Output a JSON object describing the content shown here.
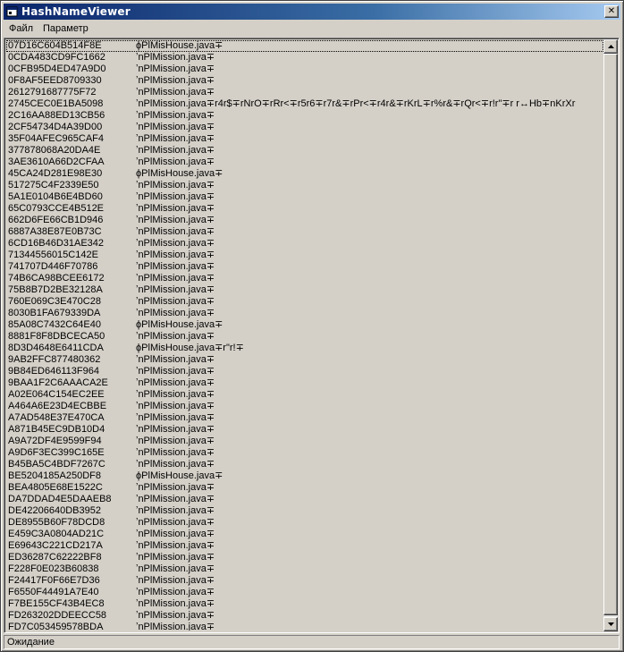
{
  "window": {
    "title": "HashNameViewer",
    "close_glyph": "✕"
  },
  "menu": {
    "items": [
      "Файл",
      "Параметр"
    ]
  },
  "list": {
    "rows": [
      {
        "hash": "07D16C604B514F8E",
        "name": "ϕPlMisHouse.java∓"
      },
      {
        "hash": "0CDA483CD9FC1662",
        "name": "ʼnPlMission.java∓"
      },
      {
        "hash": "0CFB95D4ED47A9D0",
        "name": "ʼnPlMission.java∓"
      },
      {
        "hash": "0F8AF5EED8709330",
        "name": "ʼnPlMission.java∓"
      },
      {
        "hash": "2612791687775F72",
        "name": "ʼnPlMission.java∓"
      },
      {
        "hash": "2745CEC0E1BA5098",
        "name": "ʼnPlMission.java∓r4r$∓rNrO∓rRr<∓r5r6∓r7r&∓rPr<∓r4r&∓rKrL∓r%r&∓rQr<∓r!r\"∓r r↔Hb∓nKrXr"
      },
      {
        "hash": "2C16AA88ED13CB56",
        "name": "ʼnPlMission.java∓"
      },
      {
        "hash": "2CF54734D4A39D00",
        "name": "ʼnPlMission.java∓"
      },
      {
        "hash": "35F04AFEC965CAF4",
        "name": "ʼnPlMission.java∓"
      },
      {
        "hash": "377878068A20DA4E",
        "name": "ʼnPlMission.java∓"
      },
      {
        "hash": "3AE3610A66D2CFAA",
        "name": "ʼnPlMission.java∓"
      },
      {
        "hash": "45CA24D281E98E30",
        "name": "ϕPlMisHouse.java∓"
      },
      {
        "hash": "517275C4F2339E50",
        "name": "ʼnPlMission.java∓"
      },
      {
        "hash": "5A1E0104B6E4BD60",
        "name": "ʼnPlMission.java∓"
      },
      {
        "hash": "65C0793CCE4B512E",
        "name": "ʼnPlMission.java∓"
      },
      {
        "hash": "662D6FE66CB1D946",
        "name": "ʼnPlMission.java∓"
      },
      {
        "hash": "6887A38E87E0B73C",
        "name": "ʼnPlMission.java∓"
      },
      {
        "hash": "6CD16B46D31AE342",
        "name": "ʼnPlMission.java∓"
      },
      {
        "hash": "71344556015C142E",
        "name": "ʼnPlMission.java∓"
      },
      {
        "hash": "741707D446F70786",
        "name": "ʼnPlMission.java∓"
      },
      {
        "hash": "74B6CA98BCEE6172",
        "name": "ʼnPlMission.java∓"
      },
      {
        "hash": "75B8B7D2BE32128A",
        "name": "ʼnPlMission.java∓"
      },
      {
        "hash": "760E069C3E470C28",
        "name": "ʼnPlMission.java∓"
      },
      {
        "hash": "8030B1FA679339DA",
        "name": "ʼnPlMission.java∓"
      },
      {
        "hash": "85A08C7432C64E40",
        "name": "ϕPlMisHouse.java∓"
      },
      {
        "hash": "8881F8F8DBCECA50",
        "name": "ʼnPlMission.java∓"
      },
      {
        "hash": "8D3D4648E6411CDA",
        "name": "ϕPlMisHouse.java∓r\"r!∓"
      },
      {
        "hash": "9AB2FFC877480362",
        "name": "ʼnPlMission.java∓"
      },
      {
        "hash": "9B84ED646113F964",
        "name": "ʼnPlMission.java∓"
      },
      {
        "hash": "9BAA1F2C6AAACA2E",
        "name": "ʼnPlMission.java∓"
      },
      {
        "hash": "A02E064C154EC2EE",
        "name": "ʼnPlMission.java∓"
      },
      {
        "hash": "A464A6E23D4ECBBE",
        "name": "ʼnPlMission.java∓"
      },
      {
        "hash": "A7AD548E37E470CA",
        "name": "ʼnPlMission.java∓"
      },
      {
        "hash": "A871B45EC9DB10D4",
        "name": "ʼnPlMission.java∓"
      },
      {
        "hash": "A9A72DF4E9599F94",
        "name": "ʼnPlMission.java∓"
      },
      {
        "hash": "A9D6F3EC399C165E",
        "name": "ʼnPlMission.java∓"
      },
      {
        "hash": "B45BA5C4BDF7267C",
        "name": "ʼnPlMission.java∓"
      },
      {
        "hash": "BE5204185A250DF8",
        "name": "ϕPlMisHouse.java∓"
      },
      {
        "hash": "BEA4805E68E1522C",
        "name": "ʼnPlMission.java∓"
      },
      {
        "hash": "DA7DDAD4E5DAAEB8",
        "name": "ʼnPlMission.java∓"
      },
      {
        "hash": "DE42206640DB3952",
        "name": "ʼnPlMission.java∓"
      },
      {
        "hash": "DE8955B60F78DCD8",
        "name": "ʼnPlMission.java∓"
      },
      {
        "hash": "E459C3A0804AD21C",
        "name": "ʼnPlMission.java∓"
      },
      {
        "hash": "E69643C221CD217A",
        "name": "ʼnPlMission.java∓"
      },
      {
        "hash": "ED36287C62222BF8",
        "name": "ʼnPlMission.java∓"
      },
      {
        "hash": "F228F0E023B60838",
        "name": "ʼnPlMission.java∓"
      },
      {
        "hash": "F24417F0F66E7D36",
        "name": "ʼnPlMission.java∓"
      },
      {
        "hash": "F6550F44491A7E40",
        "name": "ʼnPlMission.java∓"
      },
      {
        "hash": "F7BE155CF43B4EC8",
        "name": "ʼnPlMission.java∓"
      },
      {
        "hash": "FD263202DDEECC58",
        "name": "ʼnPlMission.java∓"
      },
      {
        "hash": "FD7C053459578BDA",
        "name": "ʼnPlMission.java∓"
      }
    ]
  },
  "status": {
    "text": "Ожидание"
  }
}
